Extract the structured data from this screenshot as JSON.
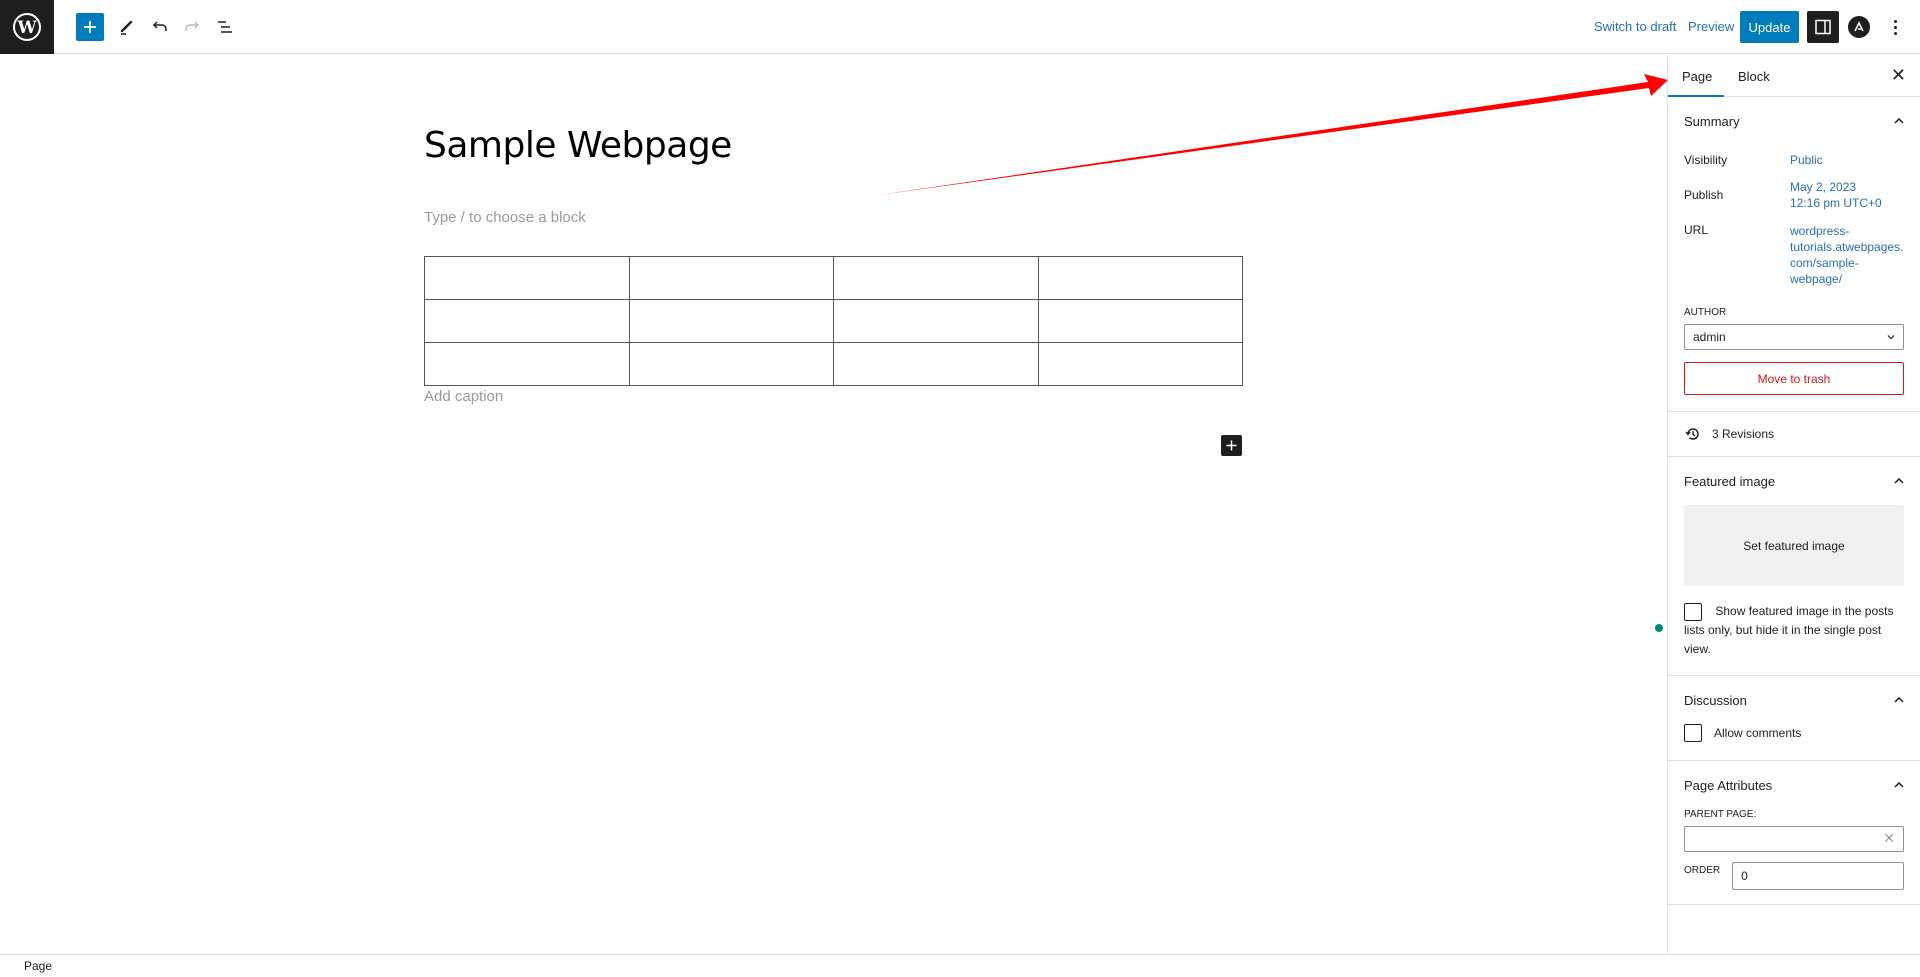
{
  "toolbar": {
    "switch_to_draft": "Switch to draft",
    "preview": "Preview",
    "update": "Update",
    "icons": [
      "wordpress-logo",
      "plus-icon",
      "pencil-icon",
      "undo-icon",
      "redo-icon",
      "list-view-icon",
      "settings-panel-icon",
      "astra-icon",
      "more-options-icon"
    ]
  },
  "editor": {
    "title": "Sample Webpage",
    "block_placeholder": "Type / to choose a block",
    "table": {
      "rows": 3,
      "columns": 4,
      "cells": [
        [
          "",
          "",
          "",
          ""
        ],
        [
          "",
          "",
          "",
          ""
        ],
        [
          "",
          "",
          "",
          ""
        ]
      ]
    },
    "caption_placeholder": "Add caption"
  },
  "sidebar": {
    "tabs": [
      {
        "label": "Page",
        "active": true
      },
      {
        "label": "Block",
        "active": false
      }
    ],
    "summary": {
      "title": "Summary",
      "visibility_label": "Visibility",
      "visibility_value": "Public",
      "publish_label": "Publish",
      "publish_date": "May 2, 2023",
      "publish_time": "12:16 pm UTC+0",
      "url_label": "URL",
      "url_value": "wordpress-tutorials.atwebpages.com/sample-webpage/",
      "url_lines": [
        "wordpress-",
        "tutorials.atwebpages.",
        "com/sample-",
        "webpage/"
      ],
      "author_label": "AUTHOR",
      "author_value": "admin",
      "trash_label": "Move to trash"
    },
    "revisions": "3 Revisions",
    "featured_image": {
      "title": "Featured image",
      "set_label": "Set featured image",
      "checkbox_label": "Show featured image in the posts lists only, but hide it in the single post view.",
      "checked": false
    },
    "discussion": {
      "title": "Discussion",
      "allow_comments_label": "Allow comments",
      "checked": false
    },
    "page_attributes": {
      "title": "Page Attributes",
      "parent_label": "PARENT PAGE:",
      "parent_value": "",
      "order_label": "ORDER",
      "order_value": "0"
    }
  },
  "footer": {
    "breadcrumb": "Page"
  },
  "annotation": {
    "color": "#ff0000"
  },
  "colors": {
    "accent": "#007cba",
    "link": "#2271b1",
    "danger": "#cc1818",
    "dark": "#1e1e1e"
  }
}
